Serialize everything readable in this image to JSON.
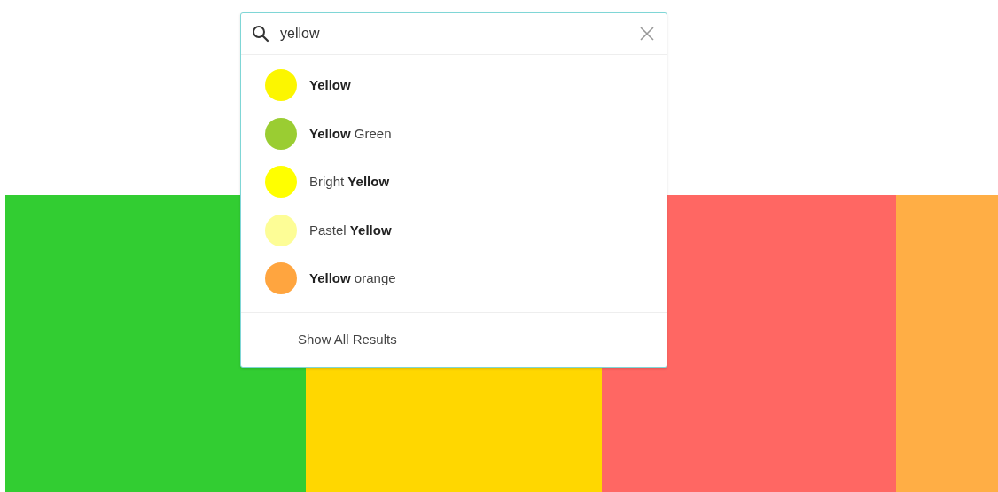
{
  "search": {
    "value": "yellow"
  },
  "results": [
    {
      "label": "**Yellow**",
      "color": "#fcf600"
    },
    {
      "label": "**Yellow** Green",
      "color": "#9acd32"
    },
    {
      "label": "Bright **Yellow**",
      "color": "#ffff00"
    },
    {
      "label": "Pastel **Yellow**",
      "color": "#fdfd96"
    },
    {
      "label": "**Yellow** orange",
      "color": "#ffa53f"
    }
  ],
  "show_all": "Show All Results",
  "swatches": [
    {
      "color": "#32cd32"
    },
    {
      "color": "#ffd700"
    },
    {
      "color": "#ff6763"
    },
    {
      "color": "#ffae45"
    }
  ]
}
